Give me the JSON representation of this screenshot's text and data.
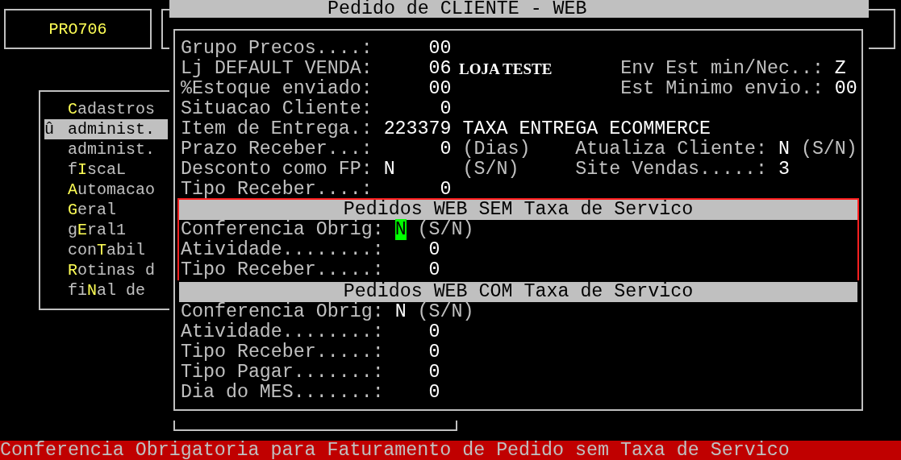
{
  "program_box": {
    "code": "PRO706"
  },
  "menu": {
    "items": [
      {
        "text": "**C**adastros",
        "selected": false
      },
      {
        "marker": "û",
        "text": "administ.",
        "selected": true
      },
      {
        "text": "administ.",
        "selected": false
      },
      {
        "text": "f**I**scaL",
        "selected": false
      },
      {
        "text": "**A**utomacao",
        "selected": false
      },
      {
        "text": "**G**eral",
        "selected": false
      },
      {
        "text": "g**E**ral1",
        "selected": false
      },
      {
        "text": "con**T**abil",
        "selected": false
      },
      {
        "text": "**R**otinas d",
        "selected": false
      },
      {
        "text": "fi**N**al de",
        "selected": false
      }
    ]
  },
  "dialog": {
    "title": "Pedido de CLIENTE - WEB",
    "fields": [
      {
        "label": "Grupo Precos....:",
        "value": "00",
        "kind": "number"
      },
      {
        "label": "Lj DEFAULT VENDA:",
        "value": "06",
        "kind": "number",
        "description": {
          "text": "LOJA TESTE",
          "kind": "serif"
        },
        "right": {
          "label": "Env Est min/Nec..:",
          "value": "Z"
        }
      },
      {
        "label": "%Estoque enviado:",
        "value": "00",
        "kind": "number",
        "right": {
          "label": "Est Minimo envio.:",
          "value": "00"
        }
      },
      {
        "label": "Situacao Cliente:",
        "value": "0",
        "kind": "number"
      },
      {
        "label": "Item de Entrega.:",
        "value": "223379",
        "kind": "number",
        "description": {
          "text": "TAXA ENTREGA ECOMMERCE",
          "kind": "mono"
        }
      },
      {
        "label": "Prazo Receber...:",
        "value": "0",
        "kind": "number",
        "suffix": "(Dias)",
        "right": {
          "label": "Atualiza Cliente:",
          "value": "N",
          "suffix": "(S/N)"
        }
      },
      {
        "label": "Desconto como FP:",
        "value": "N",
        "kind": "flag",
        "suffix": "(S/N)",
        "right": {
          "label": "Site Vendas.....:",
          "value": "3"
        }
      },
      {
        "label": "Tipo Receber....:",
        "value": "0",
        "kind": "number"
      }
    ],
    "sections": [
      {
        "title": "Pedidos WEB SEM Taxa de Servico",
        "focused": true,
        "fields": [
          {
            "label": "Conferencia Obrig:",
            "value": "N",
            "kind": "flag",
            "suffix": "(S/N)",
            "cursor": true
          },
          {
            "label": "Atividade........:",
            "value": "0",
            "kind": "number",
            "cursor": false
          },
          {
            "label": "Tipo Receber.....:",
            "value": "0",
            "kind": "number",
            "cursor": false
          }
        ]
      },
      {
        "title": "Pedidos WEB COM Taxa de Servico",
        "focused": false,
        "fields": [
          {
            "label": "Conferencia Obrig:",
            "value": "N",
            "kind": "flag",
            "suffix": "(S/N)",
            "cursor": false
          },
          {
            "label": "Atividade........:",
            "value": "0",
            "kind": "number",
            "cursor": false
          },
          {
            "label": "Tipo Receber.....:",
            "value": "0",
            "kind": "number",
            "cursor": false
          },
          {
            "label": "Tipo Pagar.......:",
            "value": "0",
            "kind": "number",
            "cursor": false
          },
          {
            "label": "Dia do MES.......:",
            "value": "0",
            "kind": "number",
            "cursor": false
          }
        ]
      }
    ]
  },
  "status_bar": {
    "message": "Conferencia Obrigatoria para Faturamento de Pedido sem Taxa de Servico"
  }
}
